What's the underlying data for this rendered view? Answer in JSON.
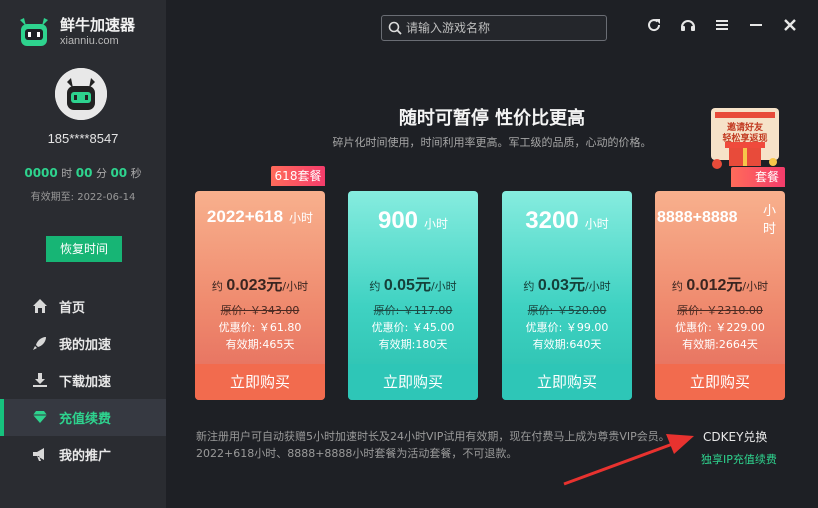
{
  "app": {
    "name": "鲜牛加速器",
    "domain": "xianniu.com"
  },
  "user": {
    "phone": "185****8547",
    "timer": {
      "hours": "0000",
      "hours_unit": "时",
      "minutes": "00",
      "minutes_unit": "分",
      "seconds": "00",
      "seconds_unit": "秒"
    },
    "expiry_label": "有效期至: 2022-06-14",
    "restore_label": "恢复时间"
  },
  "nav": {
    "items": [
      {
        "label": "首页",
        "icon": "home-icon"
      },
      {
        "label": "我的加速",
        "icon": "rocket-icon"
      },
      {
        "label": "下载加速",
        "icon": "download-icon"
      },
      {
        "label": "充值续费",
        "icon": "diamond-icon",
        "active": true
      },
      {
        "label": "我的推广",
        "icon": "megaphone-icon"
      }
    ]
  },
  "search": {
    "placeholder": "请输入游戏名称"
  },
  "header_icons": [
    "refresh-icon",
    "headset-icon",
    "menu-icon",
    "minimize-icon",
    "close-icon"
  ],
  "main": {
    "headline": "随时可暂停 性价比更高",
    "subline": "碎片化时间使用，时间利用率更高。军工级的品质，心动的价格。",
    "tag_618": "618套餐",
    "tag_right": "套餐",
    "plans": [
      {
        "hours": "2022+618",
        "unit": "小时",
        "per_prefix": "约",
        "per_price": "0.023元",
        "per_suffix": "/小时",
        "original": "原价: ￥343.00",
        "promo": "优惠价: ￥61.80",
        "valid": "有效期:465天",
        "buy": "立即购买",
        "theme": "orange"
      },
      {
        "hours": "900",
        "unit": "小时",
        "per_prefix": "约",
        "per_price": "0.05元",
        "per_suffix": "/小时",
        "original": "原价: ￥117.00",
        "promo": "优惠价: ￥45.00",
        "valid": "有效期:180天",
        "buy": "立即购买",
        "theme": "cyan"
      },
      {
        "hours": "3200",
        "unit": "小时",
        "per_prefix": "约",
        "per_price": "0.03元",
        "per_suffix": "/小时",
        "original": "原价: ￥520.00",
        "promo": "优惠价: ￥99.00",
        "valid": "有效期:640天",
        "buy": "立即购买",
        "theme": "cyan"
      },
      {
        "hours": "8888+8888",
        "unit": "小时",
        "per_prefix": "约",
        "per_price": "0.012元",
        "per_suffix": "/小时",
        "original": "原价: ￥2310.00",
        "promo": "优惠价: ￥229.00",
        "valid": "有效期:2664天",
        "buy": "立即购买",
        "theme": "orange"
      }
    ],
    "invite_banner": {
      "line1": "邀请好友",
      "line2": "轻松享返现"
    }
  },
  "footer": {
    "notice_line1": "新注册用户可自动获赠5小时加速时长及24小时VIP试用有效期，现在付费马上成为尊贵VIP会员。",
    "notice_line2": "2022+618小时、8888+8888小时套餐为活动套餐，不可退款。",
    "cdkey": "CDKEY兑换",
    "ip_link": "独享IP充值续费"
  },
  "colors": {
    "accent": "#17b575",
    "accent_text": "#2ed38e",
    "orange_card": "#ef8a6e",
    "cyan_card": "#3fd2c2",
    "arrow": "#e8322f"
  }
}
